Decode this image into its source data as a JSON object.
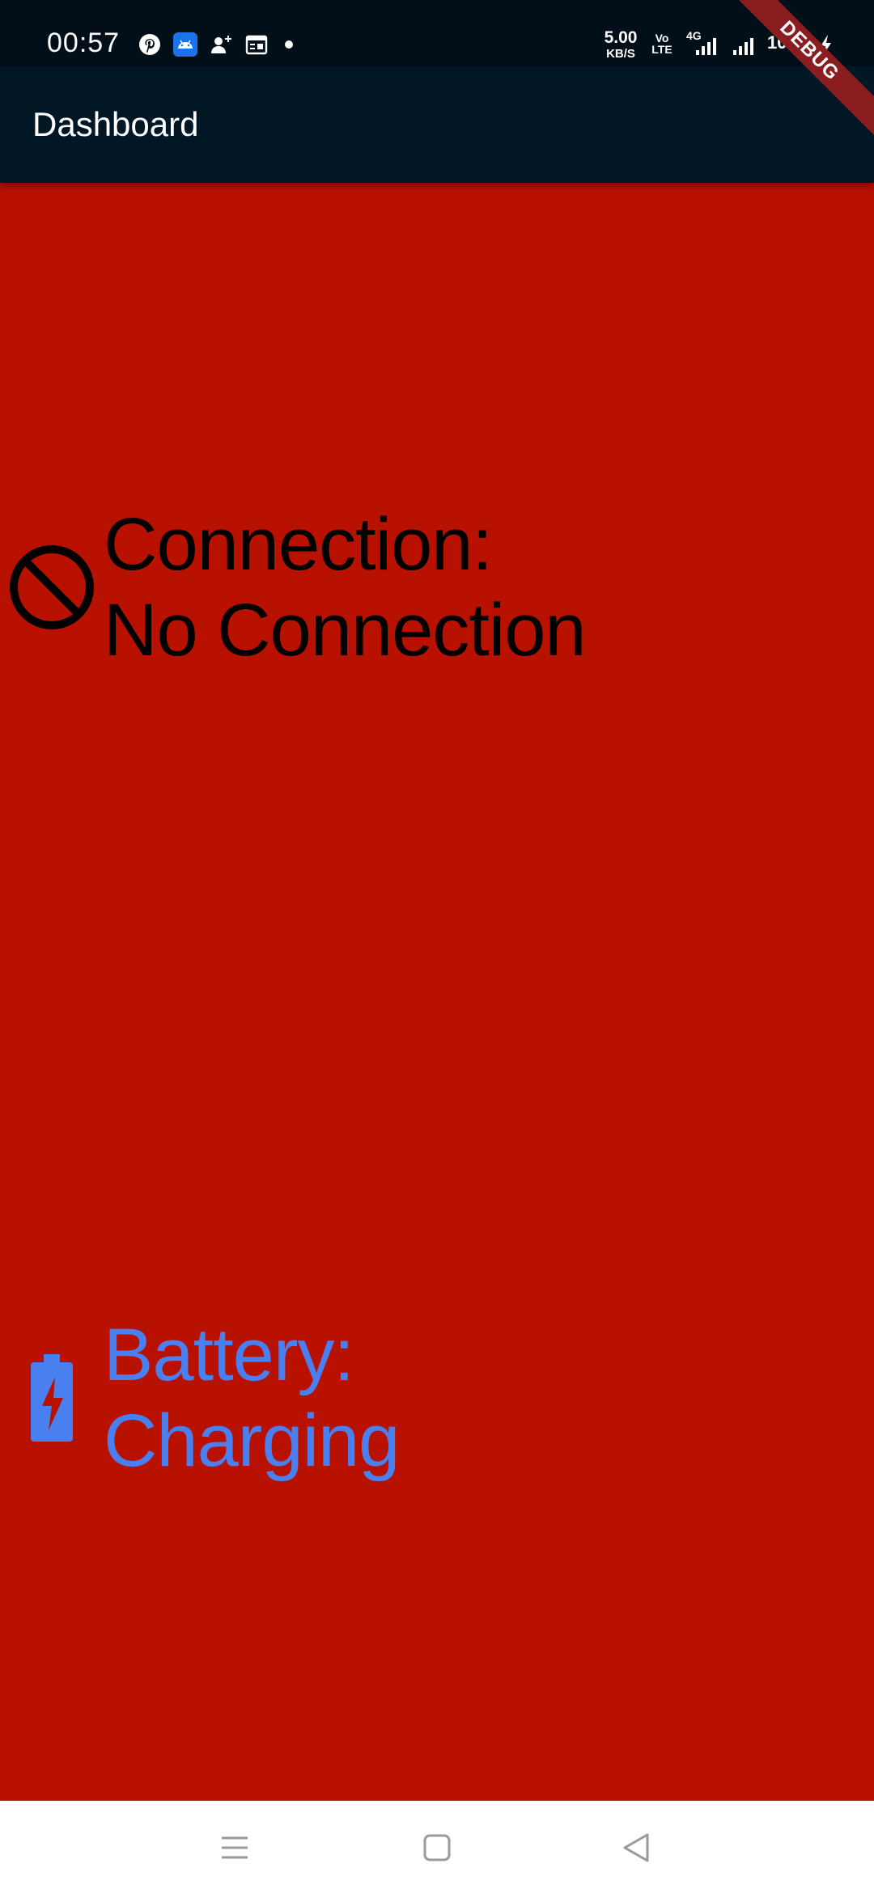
{
  "status_bar": {
    "time": "00:57",
    "net_speed_value": "5.00",
    "net_speed_unit": "KB/S",
    "volte_top": "Vo",
    "volte_bottom": "LTE",
    "network_type": "4G",
    "battery_percent": "100%",
    "icons": [
      "pinterest-icon",
      "android-icon",
      "person-add-icon",
      "calendar-icon",
      "dot-icon",
      "signal-icon",
      "signal-icon",
      "charging-icon"
    ]
  },
  "debug_banner": "DEBUG",
  "app_bar": {
    "title": "Dashboard",
    "background": "#021725"
  },
  "content": {
    "background": "#b81100",
    "connection": {
      "icon": "block-icon",
      "label": "Connection:",
      "value": "No Connection",
      "color": "#000000"
    },
    "battery": {
      "icon": "battery-charging-icon",
      "label": "Battery:",
      "value": "Charging",
      "color": "#4a7ff0"
    }
  },
  "nav_bar": {
    "buttons": [
      "menu-icon",
      "home-icon",
      "back-icon"
    ]
  }
}
